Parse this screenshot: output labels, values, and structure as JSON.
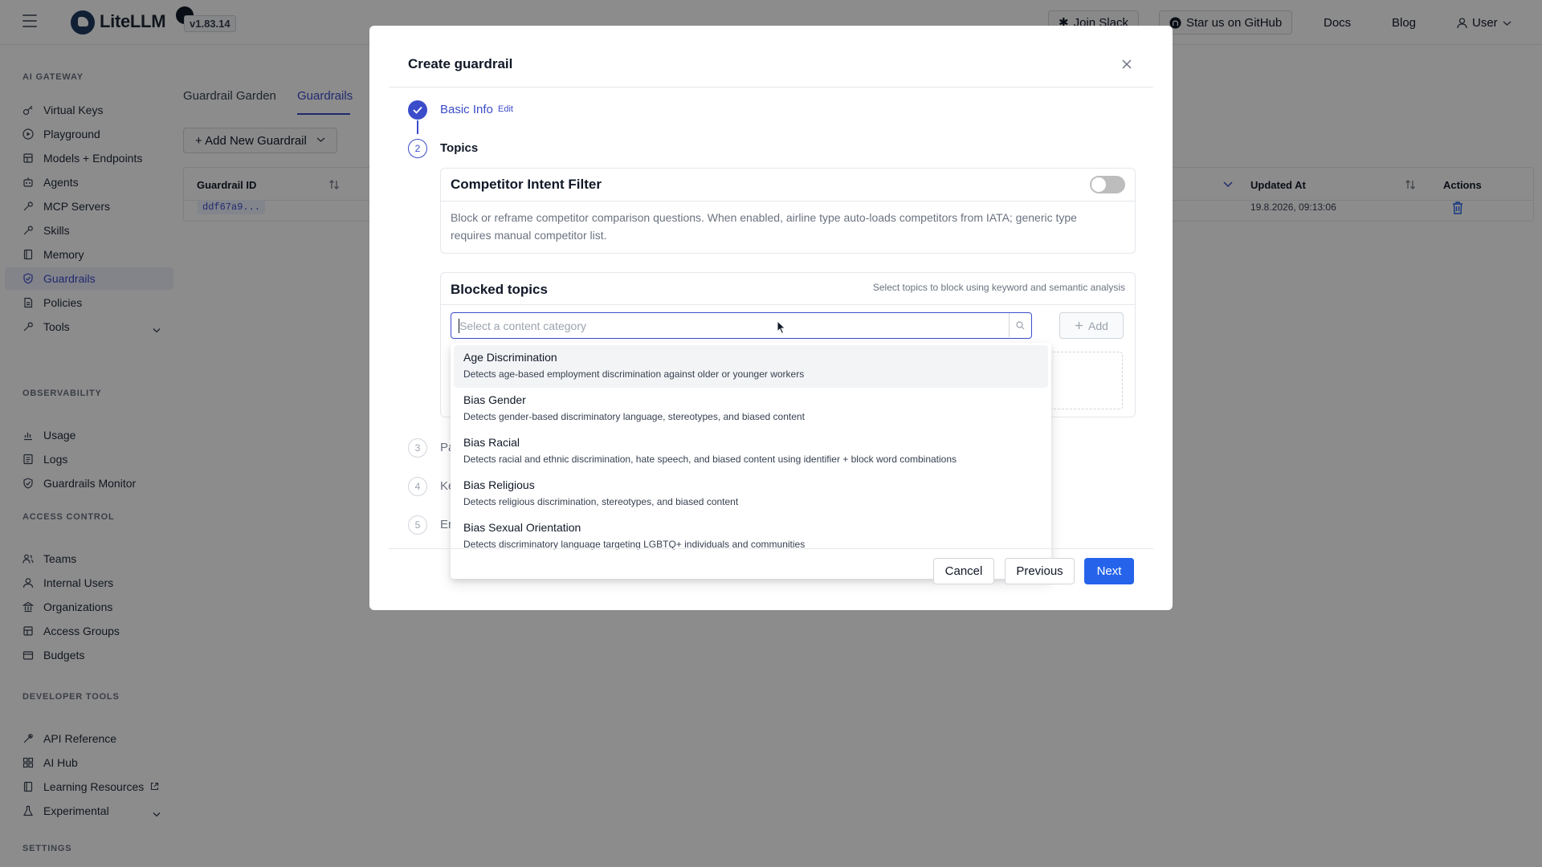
{
  "app": {
    "name": "LiteLLM",
    "version": "v1.83.14"
  },
  "topbar": {
    "join_slack": "Join Slack",
    "github": "Star us on GitHub",
    "docs": "Docs",
    "blog": "Blog",
    "user": "User"
  },
  "sidebar": {
    "sections": [
      {
        "title": "AI GATEWAY"
      },
      {
        "title": "OBSERVABILITY"
      },
      {
        "title": "ACCESS CONTROL"
      },
      {
        "title": "DEVELOPER TOOLS"
      },
      {
        "title": "SETTINGS"
      }
    ],
    "items": [
      {
        "label": "Virtual Keys",
        "icon": "key-icon"
      },
      {
        "label": "Playground",
        "icon": "play-icon"
      },
      {
        "label": "Models + Endpoints",
        "icon": "cube-icon"
      },
      {
        "label": "Agents",
        "icon": "robot-icon"
      },
      {
        "label": "MCP Servers",
        "icon": "tool-icon"
      },
      {
        "label": "Skills",
        "icon": "tool-icon"
      },
      {
        "label": "Memory",
        "icon": "book-icon"
      },
      {
        "label": "Guardrails",
        "icon": "shield-icon",
        "active": true
      },
      {
        "label": "Policies",
        "icon": "document-icon"
      },
      {
        "label": "Tools",
        "icon": "tool-icon"
      },
      {
        "label": "Usage",
        "icon": "bar-chart-icon"
      },
      {
        "label": "Logs",
        "icon": "list-icon"
      },
      {
        "label": "Guardrails Monitor",
        "icon": "shield-icon"
      },
      {
        "label": "Teams",
        "icon": "team-icon"
      },
      {
        "label": "Internal Users",
        "icon": "user-icon"
      },
      {
        "label": "Organizations",
        "icon": "bank-icon"
      },
      {
        "label": "Access Groups",
        "icon": "cube-icon"
      },
      {
        "label": "Budgets",
        "icon": "wallet-icon"
      },
      {
        "label": "API Reference",
        "icon": "api-icon"
      },
      {
        "label": "AI Hub",
        "icon": "grid-icon"
      },
      {
        "label": "Learning Resources",
        "icon": "book-icon"
      },
      {
        "label": "Experimental",
        "icon": "experiment-icon"
      }
    ]
  },
  "main": {
    "tabs": [
      "Guardrail Garden",
      "Guardrails"
    ],
    "add_button": "+ Add New Guardrail",
    "table": {
      "headers": [
        "Guardrail ID",
        "Updated At",
        "Actions"
      ],
      "row": {
        "id": "ddf67a9...",
        "updated_at": "19.8.2026, 09:13:06"
      }
    }
  },
  "modal": {
    "title": "Create guardrail",
    "steps": [
      {
        "num": "1",
        "label": "Basic Info",
        "edit": "Edit"
      },
      {
        "num": "2",
        "label": "Topics"
      },
      {
        "num": "3",
        "label": "Pa"
      },
      {
        "num": "4",
        "label": "Ke"
      },
      {
        "num": "5",
        "label": "Er"
      }
    ],
    "competitor": {
      "title": "Competitor Intent Filter",
      "desc": "Block or reframe competitor comparison questions. When enabled, airline type auto-loads competitors from IATA; generic type requires manual competitor list.",
      "enabled": false
    },
    "blocked": {
      "title": "Blocked topics",
      "hint": "Select topics to block using keyword and semantic analysis",
      "placeholder": "Select a content category",
      "add_label": "Add"
    },
    "options": [
      {
        "title": "Age Discrimination",
        "desc": "Detects age-based employment discrimination against older or younger workers"
      },
      {
        "title": "Bias Gender",
        "desc": "Detects gender-based discriminatory language, stereotypes, and biased content"
      },
      {
        "title": "Bias Racial",
        "desc": "Detects racial and ethnic discrimination, hate speech, and biased content using identifier + block word combinations"
      },
      {
        "title": "Bias Religious",
        "desc": "Detects religious discrimination, stereotypes, and biased content"
      },
      {
        "title": "Bias Sexual Orientation",
        "desc": "Detects discriminatory language targeting LGBTQ+ individuals and communities"
      }
    ],
    "footer": {
      "cancel": "Cancel",
      "previous": "Previous",
      "next": "Next"
    }
  },
  "colors": {
    "accent": "#3b4cca",
    "primary_button": "#2563eb",
    "delete": "#2563eb"
  }
}
